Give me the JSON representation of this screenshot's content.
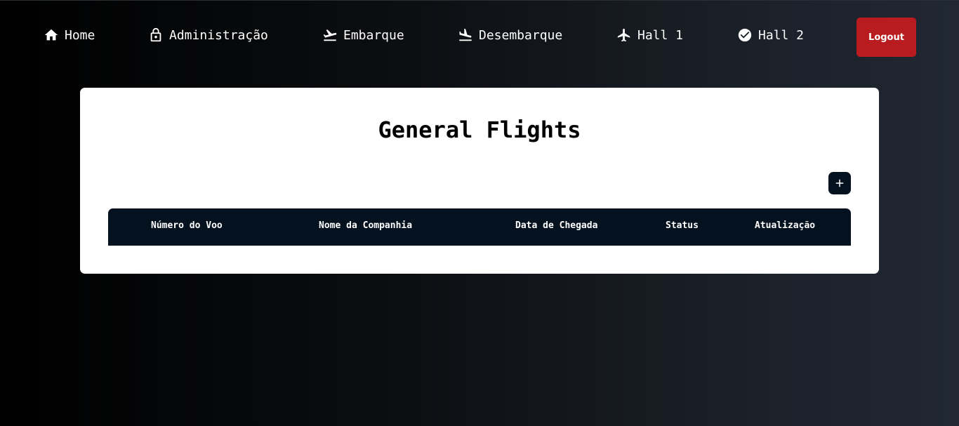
{
  "nav": {
    "items": [
      {
        "label": "Home",
        "icon": "home-icon"
      },
      {
        "label": "Administração",
        "icon": "lock-icon"
      },
      {
        "label": "Embarque",
        "icon": "flight-takeoff-icon"
      },
      {
        "label": "Desembarque",
        "icon": "flight-land-icon"
      },
      {
        "label": "Hall 1",
        "icon": "airplane-icon"
      },
      {
        "label": "Hall 2",
        "icon": "check-circle-icon"
      }
    ],
    "logout_label": "Logout"
  },
  "main": {
    "title": "General Flights",
    "add_icon": "plus-icon",
    "table": {
      "columns": [
        "Número do Voo",
        "Nome da Companhia",
        "Data de Chegada",
        "Status",
        "Atualização"
      ],
      "rows": []
    }
  },
  "colors": {
    "logout": "#b81c1f",
    "table_header": "#04121f",
    "card": "#ffffff"
  }
}
